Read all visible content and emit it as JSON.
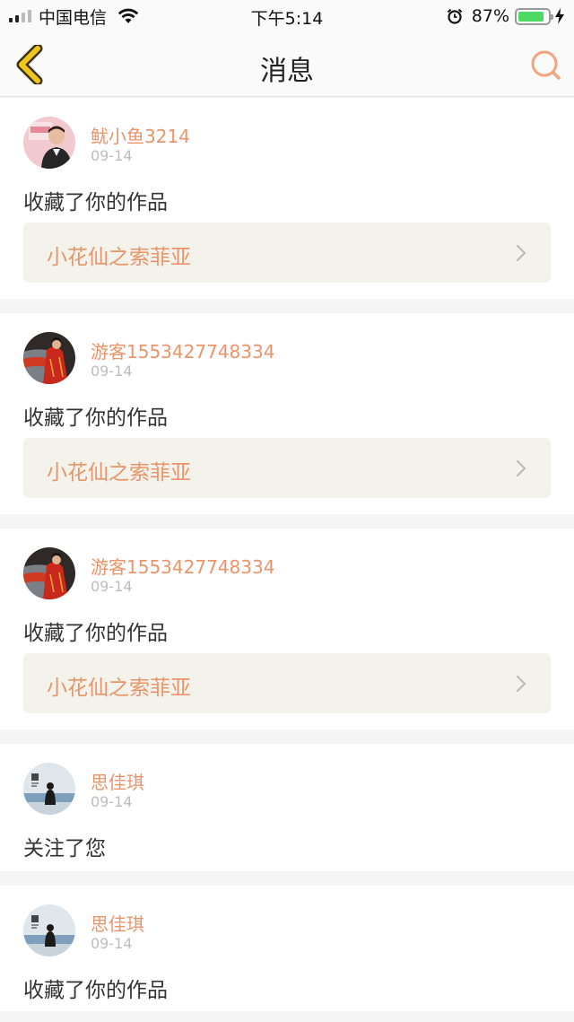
{
  "status_bar": {
    "carrier": "中国电信",
    "time": "下午5:14",
    "battery": "87%",
    "battery_level": 0.87
  },
  "nav": {
    "title": "消息",
    "back_icon": "chevron-left-icon",
    "search_icon": "search-icon"
  },
  "messages": [
    {
      "user": "鱿小鱼3214",
      "date": "09-14",
      "action": "收藏了你的作品",
      "work": "小花仙之索菲亚"
    },
    {
      "user": "游客1553427748334",
      "date": "09-14",
      "action": "收藏了你的作品",
      "work": "小花仙之索菲亚"
    },
    {
      "user": "游客1553427748334",
      "date": "09-14",
      "action": "收藏了你的作品",
      "work": "小花仙之索菲亚"
    },
    {
      "user": "思佳琪",
      "date": "09-14",
      "action": "关注了您"
    },
    {
      "user": "思佳琪",
      "date": "09-14",
      "action": "收藏了你的作品"
    }
  ],
  "colors": {
    "accent": "#e9946a",
    "card_background": "#ffffff",
    "page_background": "#f6f5f5",
    "work_background": "#f3f3ec",
    "back_icon": "#e8b90c"
  }
}
